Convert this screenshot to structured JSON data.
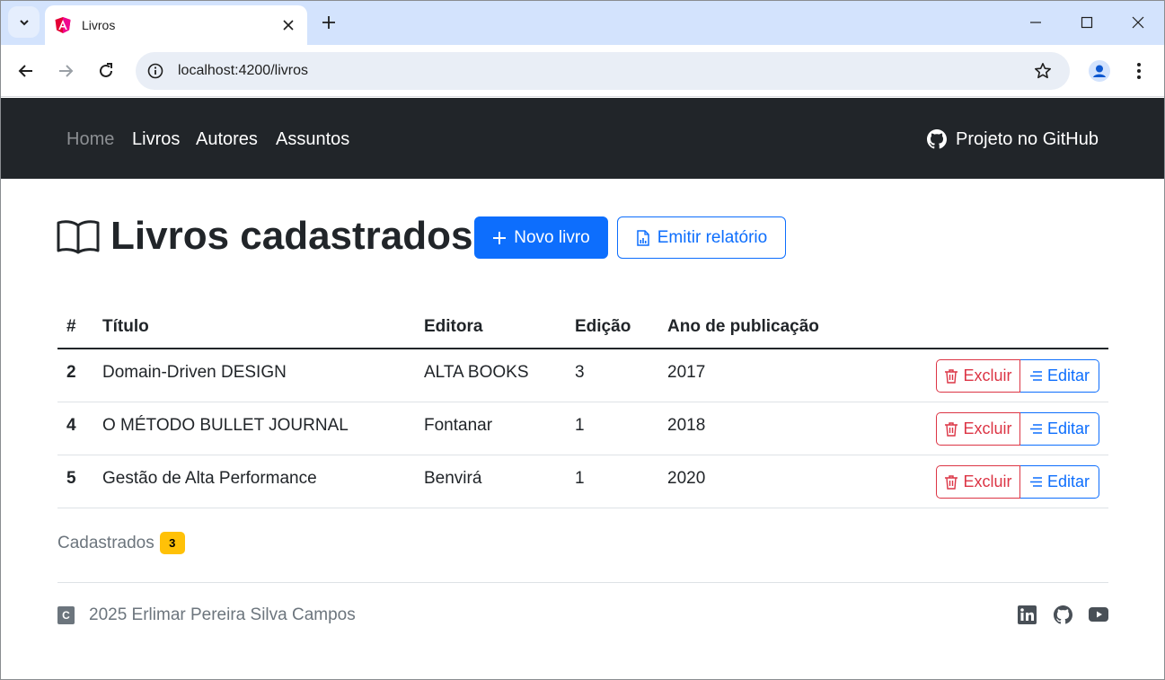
{
  "browser": {
    "tab_title": "Livros",
    "url": "localhost:4200/livros"
  },
  "navbar": {
    "links": [
      {
        "label": "Home"
      },
      {
        "label": "Livros"
      },
      {
        "label": "Autores"
      },
      {
        "label": "Assuntos"
      }
    ],
    "github_label": "Projeto no GitHub"
  },
  "main": {
    "title": "Livros cadastrados",
    "new_button": "Novo livro",
    "report_button": "Emitir relatório",
    "table": {
      "headers": [
        "#",
        "Título",
        "Editora",
        "Edição",
        "Ano de publicação"
      ],
      "rows": [
        {
          "id": "2",
          "titulo": "Domain-Driven DESIGN",
          "editora": "ALTA BOOKS",
          "edicao": "3",
          "ano": "2017"
        },
        {
          "id": "4",
          "titulo": "O MÉTODO BULLET JOURNAL",
          "editora": "Fontanar",
          "edicao": "1",
          "ano": "2018"
        },
        {
          "id": "5",
          "titulo": "Gestão de Alta Performance",
          "editora": "Benvirá",
          "edicao": "1",
          "ano": "2020"
        }
      ],
      "delete_label": "Excluir",
      "edit_label": "Editar"
    },
    "count_label": "Cadastrados",
    "count_value": "3"
  },
  "footer": {
    "copyright_icon": "C",
    "copyright_text": "2025 Erlimar Pereira Silva Campos",
    "social_icons": [
      "linkedin-icon",
      "github-icon",
      "youtube-icon"
    ]
  },
  "colors": {
    "navbar_bg": "#212529",
    "primary": "#0d6efd",
    "danger": "#dc3545",
    "badge": "#ffc107",
    "muted": "#6c757d"
  }
}
